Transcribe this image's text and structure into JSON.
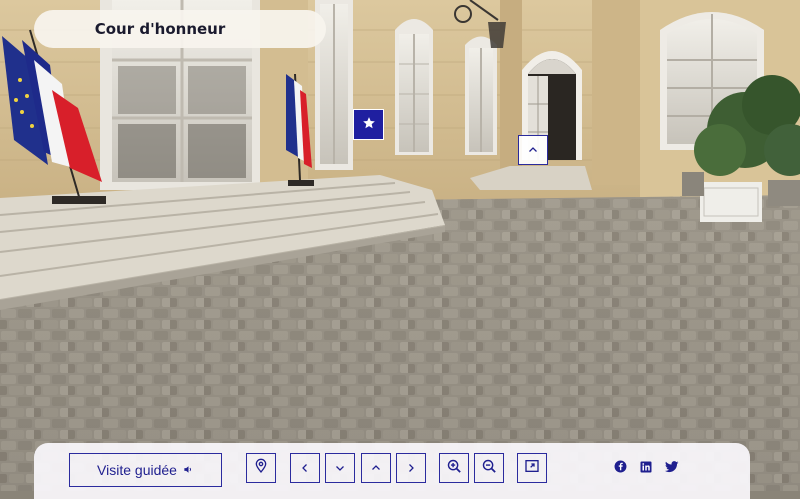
{
  "location": {
    "title": "Cour d'honneur"
  },
  "hotspots": {
    "info_icon": "star-icon",
    "nav_icon": "chevron-up-icon"
  },
  "toolbar": {
    "guided_tour_label": "Visite guidée",
    "guided_tour_icon": "speaker-icon",
    "controls": [
      "map-pin-icon",
      "chevron-left-icon",
      "chevron-down-icon",
      "chevron-up-icon",
      "chevron-right-icon",
      "zoom-in-icon",
      "zoom-out-icon",
      "fullscreen-icon"
    ],
    "social": [
      "facebook-icon",
      "linkedin-icon",
      "twitter-icon"
    ]
  },
  "colors": {
    "accent": "#1f1fa0",
    "panel": "#f8f6f9",
    "stone": "#d8c49a"
  }
}
